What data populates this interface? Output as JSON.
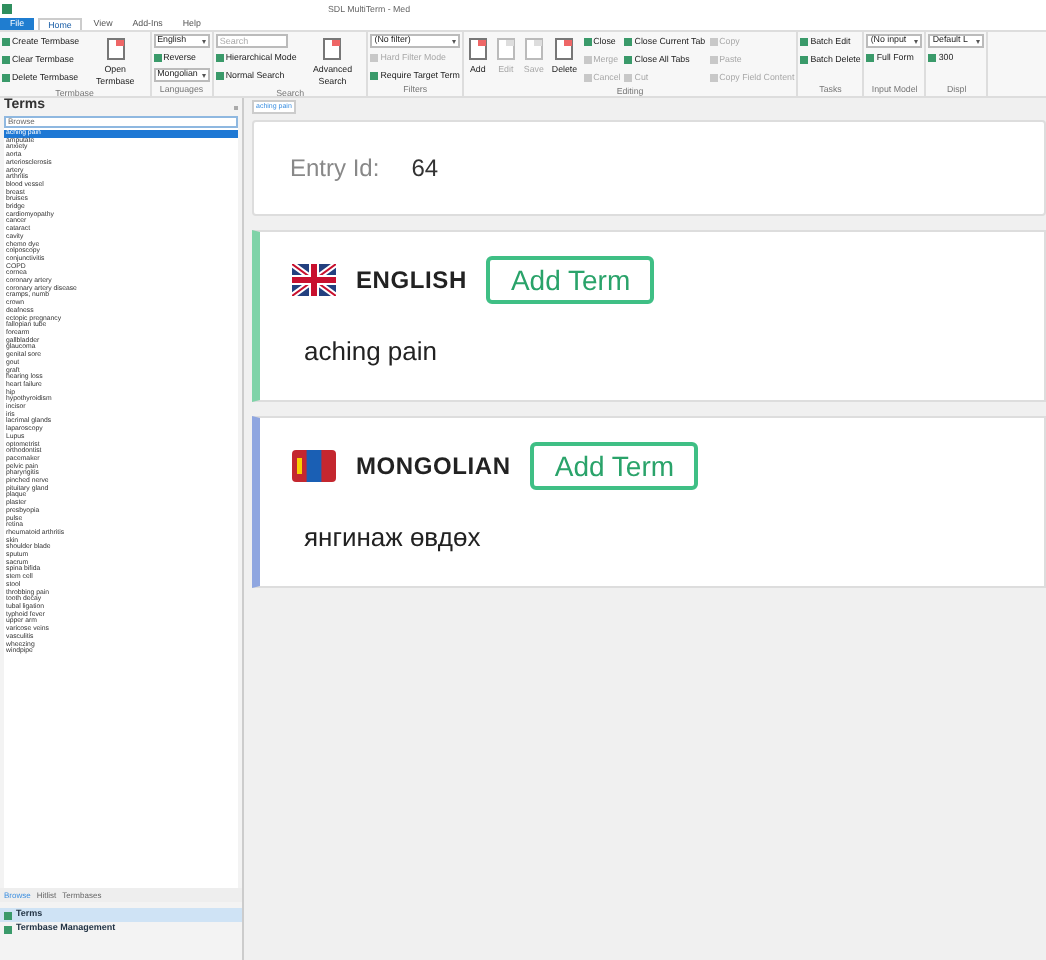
{
  "window": {
    "title": "SDL MultiTerm - Med"
  },
  "menu_tabs": [
    {
      "label": "File",
      "selected": false,
      "kind": "file"
    },
    {
      "label": "Home",
      "selected": true,
      "kind": "tab"
    },
    {
      "label": "View",
      "selected": false,
      "kind": "tab"
    },
    {
      "label": "Add-Ins",
      "selected": false,
      "kind": "tab"
    },
    {
      "label": "Help",
      "selected": false,
      "kind": "tab"
    }
  ],
  "ribbon": [
    {
      "label": "Termbase",
      "columns": [
        [
          {
            "kind": "small",
            "label": "Create Termbase",
            "disabled": false
          },
          {
            "kind": "small",
            "label": "Clear Termbase",
            "disabled": false
          },
          {
            "kind": "small",
            "label": "Delete Termbase",
            "disabled": false
          }
        ],
        [
          {
            "kind": "large",
            "label": "Open Termbase",
            "disabled": false
          }
        ]
      ]
    },
    {
      "label": "Languages",
      "columns": [
        [
          {
            "kind": "dropdown",
            "label": "English",
            "disabled": false
          },
          {
            "kind": "small",
            "label": "Reverse",
            "disabled": false
          },
          {
            "kind": "dropdown",
            "label": "Mongolian",
            "disabled": false
          }
        ]
      ]
    },
    {
      "label": "Search",
      "columns": [
        [
          {
            "kind": "field",
            "placeholder": "Search"
          },
          {
            "kind": "small",
            "label": "Hierarchical Mode",
            "disabled": false
          },
          {
            "kind": "small",
            "label": "Normal Search",
            "disabled": false
          }
        ],
        [
          {
            "kind": "large",
            "label": "Advanced Search",
            "disabled": false
          }
        ]
      ]
    },
    {
      "label": "Filters",
      "columns": [
        [
          {
            "kind": "dropdown",
            "label": "(No filter)",
            "disabled": false
          },
          {
            "kind": "small",
            "label": "Hard Filter Mode",
            "disabled": true
          },
          {
            "kind": "small",
            "label": "Require Target Term",
            "disabled": false
          }
        ]
      ]
    },
    {
      "label": "Editing",
      "columns": [
        [
          {
            "kind": "large",
            "label": "Add",
            "disabled": false
          }
        ],
        [
          {
            "kind": "large",
            "label": "Edit",
            "disabled": true
          }
        ],
        [
          {
            "kind": "large",
            "label": "Save",
            "disabled": true
          }
        ],
        [
          {
            "kind": "large",
            "label": "Delete",
            "disabled": false
          }
        ],
        [
          {
            "kind": "small",
            "label": "Close",
            "disabled": false
          },
          {
            "kind": "small",
            "label": "Merge",
            "disabled": true
          },
          {
            "kind": "small",
            "label": "Cancel",
            "disabled": true
          }
        ],
        [
          {
            "kind": "small",
            "label": "Close Current Tab",
            "disabled": false
          },
          {
            "kind": "small",
            "label": "Close All Tabs",
            "disabled": false
          },
          {
            "kind": "small",
            "label": "Cut",
            "disabled": true
          }
        ],
        [
          {
            "kind": "small",
            "label": "Copy",
            "disabled": true
          },
          {
            "kind": "small",
            "label": "Paste",
            "disabled": true
          },
          {
            "kind": "small",
            "label": "Copy Field Content",
            "disabled": true
          }
        ]
      ]
    },
    {
      "label": "Tasks",
      "columns": [
        [
          {
            "kind": "small",
            "label": "Batch Edit",
            "disabled": false
          },
          {
            "kind": "small",
            "label": "Batch Delete",
            "disabled": false
          }
        ]
      ]
    },
    {
      "label": "Input Model",
      "columns": [
        [
          {
            "kind": "dropdown",
            "label": "(No input",
            "disabled": false
          },
          {
            "kind": "small",
            "label": "Full Form",
            "disabled": false
          }
        ]
      ]
    },
    {
      "label": "Displ",
      "columns": [
        [
          {
            "kind": "dropdown",
            "label": "Default L",
            "disabled": false
          },
          {
            "kind": "small",
            "label": "300",
            "disabled": false
          }
        ]
      ]
    }
  ],
  "terms_panel": {
    "title": "Terms",
    "search": {
      "placeholder": "Browse"
    },
    "items": [
      {
        "label": "aching pain",
        "selected": true
      },
      {
        "label": "amputate",
        "selected": false
      },
      {
        "label": "anxiety",
        "selected": false
      },
      {
        "label": "aorta",
        "selected": false
      },
      {
        "label": "arteriosclerosis",
        "selected": false
      },
      {
        "label": "artery",
        "selected": false
      },
      {
        "label": "arthritis",
        "selected": false
      },
      {
        "label": "blood vessel",
        "selected": false
      },
      {
        "label": "breast",
        "selected": false
      },
      {
        "label": "bruises",
        "selected": false
      },
      {
        "label": "bridge",
        "selected": false
      },
      {
        "label": "cardiomyopathy",
        "selected": false
      },
      {
        "label": "cancer",
        "selected": false
      },
      {
        "label": "cataract",
        "selected": false
      },
      {
        "label": "cavity",
        "selected": false
      },
      {
        "label": "chemo dye",
        "selected": false
      },
      {
        "label": "colposcopy",
        "selected": false
      },
      {
        "label": "conjunctivitis",
        "selected": false
      },
      {
        "label": "COPD",
        "selected": false
      },
      {
        "label": "cornea",
        "selected": false
      },
      {
        "label": "coronary artery",
        "selected": false
      },
      {
        "label": "coronary artery disease",
        "selected": false
      },
      {
        "label": "cramps, numb",
        "selected": false
      },
      {
        "label": "crown",
        "selected": false
      },
      {
        "label": "deafness",
        "selected": false
      },
      {
        "label": "ectopic pregnancy",
        "selected": false
      },
      {
        "label": "fallopian tube",
        "selected": false
      },
      {
        "label": "forearm",
        "selected": false
      },
      {
        "label": "gallbladder",
        "selected": false
      },
      {
        "label": "glaucoma",
        "selected": false
      },
      {
        "label": "genital sore",
        "selected": false
      },
      {
        "label": "gout",
        "selected": false
      },
      {
        "label": "graft",
        "selected": false
      },
      {
        "label": "hearing loss",
        "selected": false
      },
      {
        "label": "heart failure",
        "selected": false
      },
      {
        "label": "hip",
        "selected": false
      },
      {
        "label": "hypothyroidism",
        "selected": false
      },
      {
        "label": "incisor",
        "selected": false
      },
      {
        "label": "iris",
        "selected": false
      },
      {
        "label": "lacrimal glands",
        "selected": false
      },
      {
        "label": "laparoscopy",
        "selected": false
      },
      {
        "label": "Lupus",
        "selected": false
      },
      {
        "label": "optometrist",
        "selected": false
      },
      {
        "label": "orthodontist",
        "selected": false
      },
      {
        "label": "pacemaker",
        "selected": false
      },
      {
        "label": "pelvic pain",
        "selected": false
      },
      {
        "label": "pharyngitis",
        "selected": false
      },
      {
        "label": "pinched nerve",
        "selected": false
      },
      {
        "label": "pituitary gland",
        "selected": false
      },
      {
        "label": "plaque",
        "selected": false
      },
      {
        "label": "plaster",
        "selected": false
      },
      {
        "label": "presbyopia",
        "selected": false
      },
      {
        "label": "pulse",
        "selected": false
      },
      {
        "label": "retina",
        "selected": false
      },
      {
        "label": "rheumatoid arthritis",
        "selected": false
      },
      {
        "label": "skin",
        "selected": false
      },
      {
        "label": "shoulder blade",
        "selected": false
      },
      {
        "label": "sputum",
        "selected": false
      },
      {
        "label": "sacrum",
        "selected": false
      },
      {
        "label": "spina bifida",
        "selected": false
      },
      {
        "label": "stem cell",
        "selected": false
      },
      {
        "label": "stool",
        "selected": false
      },
      {
        "label": "throbbing pain",
        "selected": false
      },
      {
        "label": "tooth decay",
        "selected": false
      },
      {
        "label": "tubal ligation",
        "selected": false
      },
      {
        "label": "typhoid fever",
        "selected": false
      },
      {
        "label": "upper arm",
        "selected": false
      },
      {
        "label": "varicose veins",
        "selected": false
      },
      {
        "label": "vasculitis",
        "selected": false
      },
      {
        "label": "wheezing",
        "selected": false
      },
      {
        "label": "windpipe",
        "selected": false
      }
    ],
    "bottom_tabs": [
      {
        "label": "Browse",
        "selected": true
      },
      {
        "label": "Hitlist",
        "selected": false
      },
      {
        "label": "Termbases",
        "selected": false
      }
    ]
  },
  "nav": [
    {
      "label": "Terms",
      "selected": true
    },
    {
      "label": "Termbase Management",
      "selected": false
    }
  ],
  "document_tab": {
    "label": "aching pain"
  },
  "entry": {
    "label": "Entry Id:",
    "value": "64"
  },
  "languages": [
    {
      "name": "ENGLISH",
      "button": "Add Term",
      "term": "aching pain",
      "color": "#7fd3a8"
    },
    {
      "name": "MONGOLIAN",
      "button": "Add Term",
      "term": "янгинаж өвдөх",
      "color": "#8fa6e0"
    }
  ]
}
